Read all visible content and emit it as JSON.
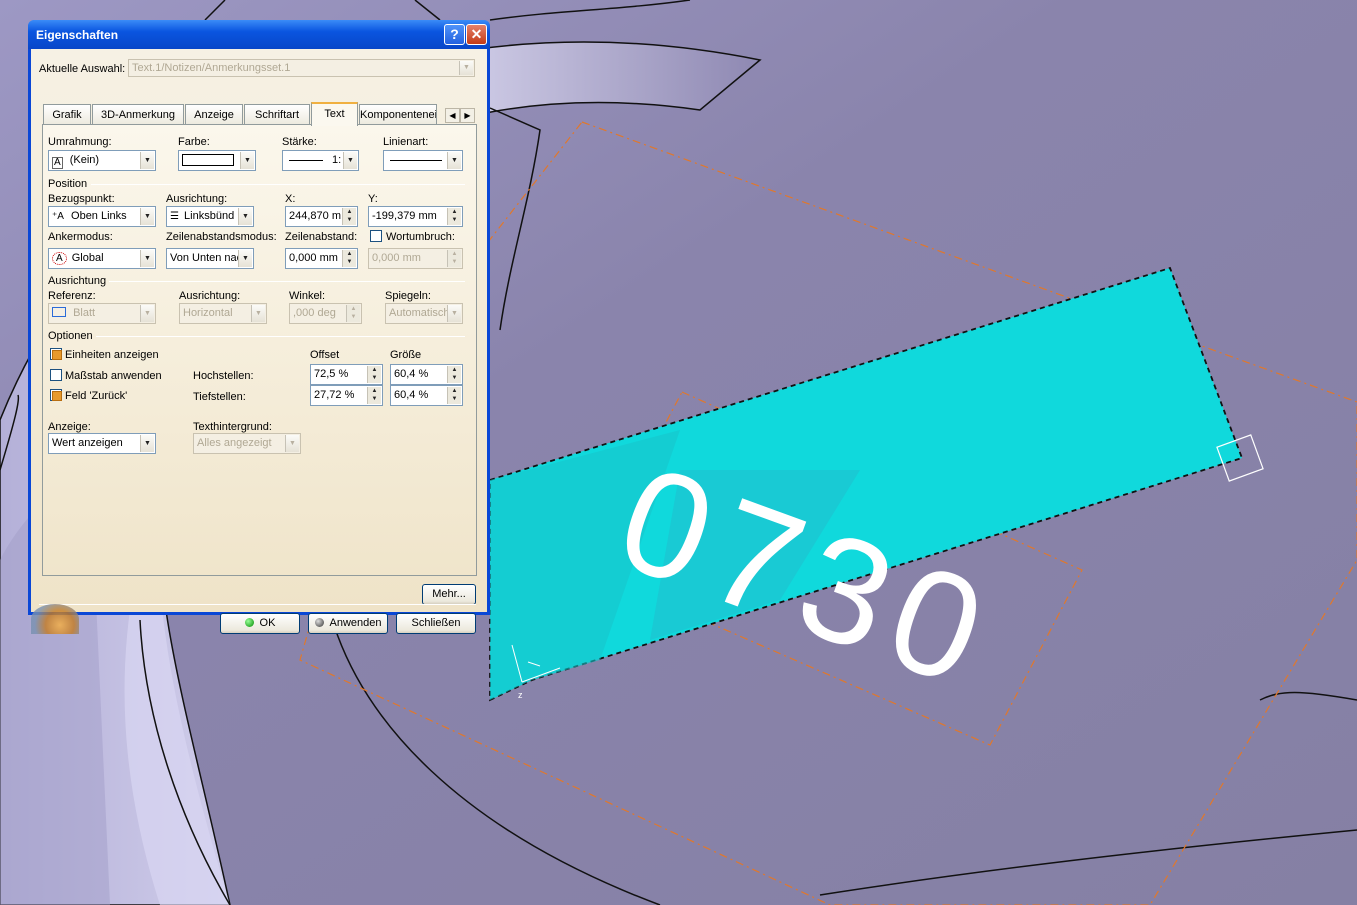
{
  "dialog": {
    "title": "Eigenschaften",
    "help_glyph": "?",
    "close_glyph": "✕",
    "current_selection_label": "Aktuelle Auswahl:",
    "current_selection_value": "Text.1/Notizen/Anmerkungsset.1",
    "tabs": [
      "Grafik",
      "3D-Anmerkung",
      "Anzeige",
      "Schriftart",
      "Text",
      "Komponenteneig"
    ],
    "active_tab": "Text",
    "frame": {
      "umrahmung_label": "Umrahmung:",
      "umrahmung_value": "(Kein)",
      "farbe_label": "Farbe:",
      "staerke_label": "Stärke:",
      "staerke_value": "1:",
      "linienart_label": "Linienart:"
    },
    "position": {
      "section_label": "Position",
      "bezugspunkt_label": "Bezugspunkt:",
      "bezugspunkt_value": "Oben Links",
      "ausrichtung_label": "Ausrichtung:",
      "ausrichtung_value": "Linksbünd",
      "x_label": "X:",
      "x_value": "244,870 m",
      "y_label": "Y:",
      "y_value": "-199,379 mm",
      "ankermodus_label": "Ankermodus:",
      "ankermodus_value": "Global",
      "zeilenabstandsmodus_label": "Zeilenabstandsmodus:",
      "zeilenabstandsmodus_value": "Von Unten nac",
      "zeilenabstand_label": "Zeilenabstand:",
      "zeilenabstand_value": "0,000 mm",
      "wortumbruch_label": "Wortumbruch:",
      "wortumbruch_value": "0,000 mm"
    },
    "orientation": {
      "section_label": "Ausrichtung",
      "referenz_label": "Referenz:",
      "referenz_value": "Blatt",
      "ausrichtung_label": "Ausrichtung:",
      "ausrichtung_value": "Horizontal",
      "winkel_label": "Winkel:",
      "winkel_value": ",000 deg",
      "spiegeln_label": "Spiegeln:",
      "spiegeln_value": "Automatisch"
    },
    "options": {
      "section_label": "Optionen",
      "offset_header": "Offset",
      "groesse_header": "Größe",
      "einheiten_label": "Einheiten anzeigen",
      "massstab_label": "Maßstab anwenden",
      "feld_label": "Feld 'Zurück'",
      "hochstellen_label": "Hochstellen:",
      "hochstellen_offset": "72,5 %",
      "hochstellen_groesse": "60,4 %",
      "tiefstellen_label": "Tiefstellen:",
      "tiefstellen_offset": "27,72 %",
      "tiefstellen_groesse": "60,4 %"
    },
    "display": {
      "anzeige_label": "Anzeige:",
      "anzeige_value": "Wert anzeigen",
      "texthintergrund_label": "Texthintergrund:",
      "texthintergrund_value": "Alles angezeigt"
    },
    "buttons": {
      "more": "Mehr...",
      "ok": "OK",
      "apply": "Anwenden",
      "close": "Schließen"
    }
  },
  "canvas": {
    "annotation_text": "0730",
    "background_color": "#8a84a8",
    "annotation_fill": "#10d9dc",
    "guide_color": "#e0782c"
  }
}
